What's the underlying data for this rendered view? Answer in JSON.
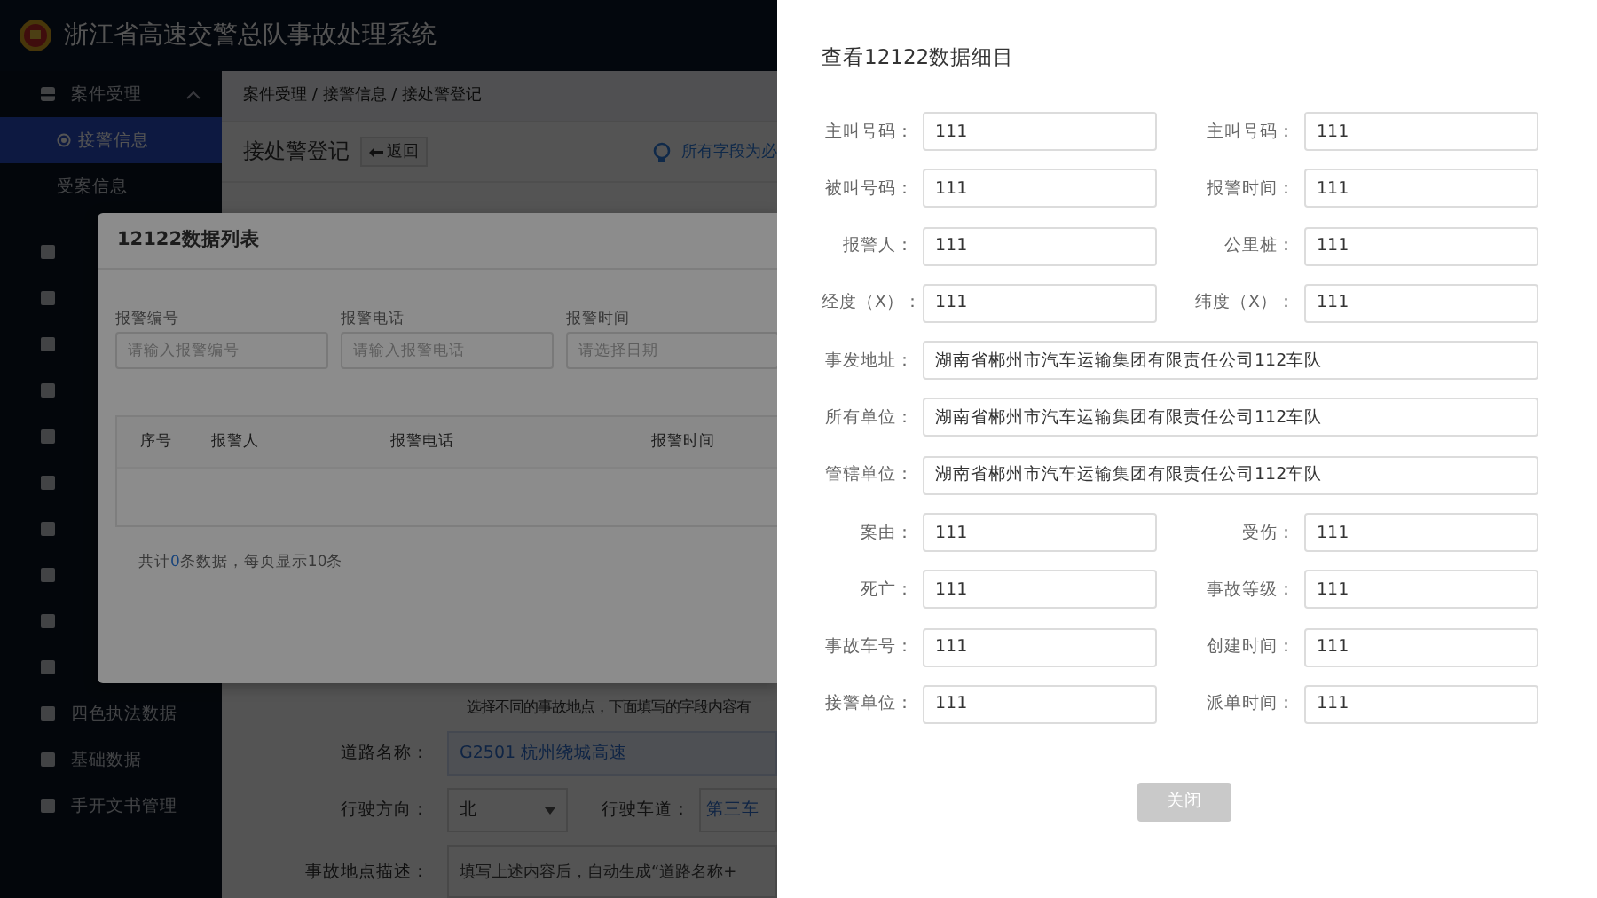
{
  "header": {
    "title": "浙江省高速交警总队事故处理系统"
  },
  "sidebar": {
    "groups": [
      {
        "label": "案件受理",
        "expanded": true,
        "children": [
          {
            "label": "接警信息",
            "selected": true
          },
          {
            "label": "受案信息",
            "selected": false
          }
        ]
      }
    ],
    "items": [
      {
        "label": "四色执法数据",
        "selected": false
      },
      {
        "label": "基础数据",
        "selected": false
      },
      {
        "label": "手开文书管理",
        "selected": false
      }
    ]
  },
  "content": {
    "breadcrumb": "案件受理 / 接警信息 / 接处警登记",
    "title": "接处警登记",
    "back_button": "返回",
    "notice": "所有字段为必",
    "form": {
      "hint": "选择不同的事故地点，下面填写的字段内容有",
      "rows": [
        {
          "kind": "text",
          "label": "道路名称：",
          "value": "G2501 杭州绕城高速"
        },
        {
          "kind": "pair",
          "label": "行驶方向：",
          "value": "北",
          "label_2": "行驶车道：",
          "value_2": "第三车"
        },
        {
          "kind": "textarea",
          "label": "事故地点描述：",
          "placeholder": "填写上述内容后，自动生成“道路名称+"
        }
      ]
    }
  },
  "modal": {
    "title": "12122数据列表",
    "filters": [
      {
        "label": "报警编号",
        "placeholder": "请输入报警编号"
      },
      {
        "label": "报警电话",
        "placeholder": "请输入报警电话"
      },
      {
        "label": "报警时间",
        "placeholder": "请选择日期"
      }
    ],
    "table": {
      "columns": [
        "序号",
        "报警人",
        "报警电话",
        "报警时间"
      ]
    },
    "pagination": {
      "prefix": "共计",
      "count": "0",
      "suffix": "条数据，每页显示10条"
    }
  },
  "drawer": {
    "title": "查看12122数据细目",
    "fields": [
      {
        "kind": "half",
        "label": "主叫号码：",
        "value": "111"
      },
      {
        "kind": "half",
        "label": "主叫号码：",
        "value": "111"
      },
      {
        "kind": "half",
        "label": "被叫号码：",
        "value": "111"
      },
      {
        "kind": "half",
        "label": "报警时间：",
        "value": "111"
      },
      {
        "kind": "half",
        "label": "报警人：",
        "value": "111"
      },
      {
        "kind": "half",
        "label": "公里桩：",
        "value": "111"
      },
      {
        "kind": "half",
        "label": "经度（X）：",
        "value": "111"
      },
      {
        "kind": "half",
        "label": "纬度（X）：",
        "value": "111"
      },
      {
        "kind": "full",
        "label": "事发地址：",
        "value": "湖南省郴州市汽车运输集团有限责任公司112车队"
      },
      {
        "kind": "full",
        "label": "所有单位：",
        "value": "湖南省郴州市汽车运输集团有限责任公司112车队"
      },
      {
        "kind": "full",
        "label": "管辖单位：",
        "value": "湖南省郴州市汽车运输集团有限责任公司112车队"
      },
      {
        "kind": "half",
        "label": "案由：",
        "value": "111"
      },
      {
        "kind": "half",
        "label": "受伤：",
        "value": "111"
      },
      {
        "kind": "half",
        "label": "死亡：",
        "value": "111"
      },
      {
        "kind": "half",
        "label": "事故等级：",
        "value": "111"
      },
      {
        "kind": "half",
        "label": "事故车号：",
        "value": "111"
      },
      {
        "kind": "half",
        "label": "创建时间：",
        "value": "111"
      },
      {
        "kind": "half",
        "label": "接警单位：",
        "value": "111"
      },
      {
        "kind": "half",
        "label": "派单时间：",
        "value": "111"
      }
    ],
    "close_button": "关闭"
  }
}
